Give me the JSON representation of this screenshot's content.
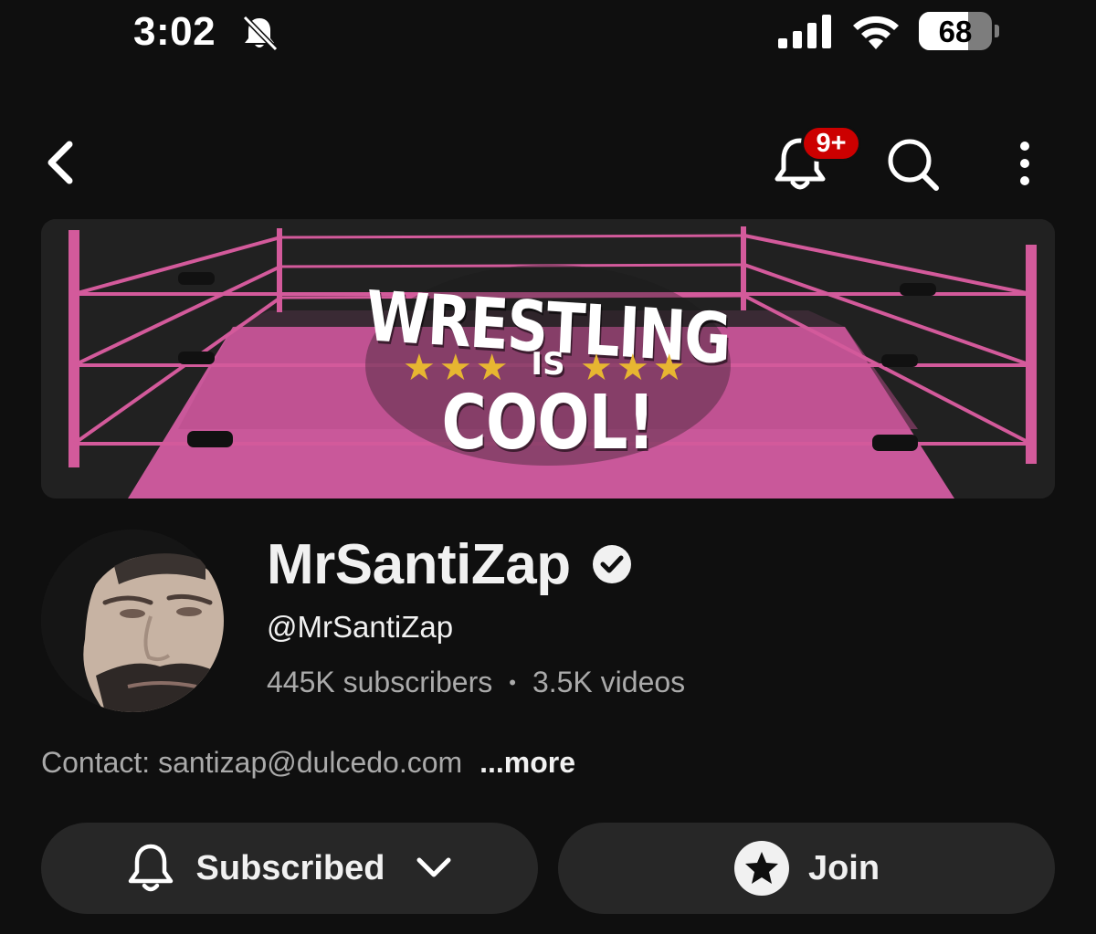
{
  "status_bar": {
    "time": "3:02",
    "battery": "68",
    "battery_level_percent": 68,
    "icons": [
      "bell-slash-icon",
      "cellular-signal-icon",
      "wifi-icon",
      "battery-icon"
    ]
  },
  "top_bar": {
    "icons": [
      "back-chevron-icon",
      "notification-bell-icon",
      "search-icon",
      "more-vertical-icon"
    ],
    "notification_badge": "9+"
  },
  "banner": {
    "line1": "WRESTLING",
    "line2": "IS",
    "line3": "COOL!",
    "colors": {
      "ring_pink": "#d35a9b",
      "star_gold": "#e7b631",
      "background": "#202020"
    }
  },
  "channel": {
    "name": "MrSantiZap",
    "handle": "@MrSantiZap",
    "subscribers": "445K subscribers",
    "separator": "•",
    "videos": "3.5K videos",
    "description": "Contact: santizap@dulcedo.com",
    "more_label": "...more"
  },
  "actions": {
    "subscribed_label": "Subscribed",
    "join_label": "Join"
  },
  "colors": {
    "background": "#0f0f0f",
    "button_bg": "#272727",
    "secondary_text": "#aaaaaa",
    "badge_red": "#cc0000"
  }
}
